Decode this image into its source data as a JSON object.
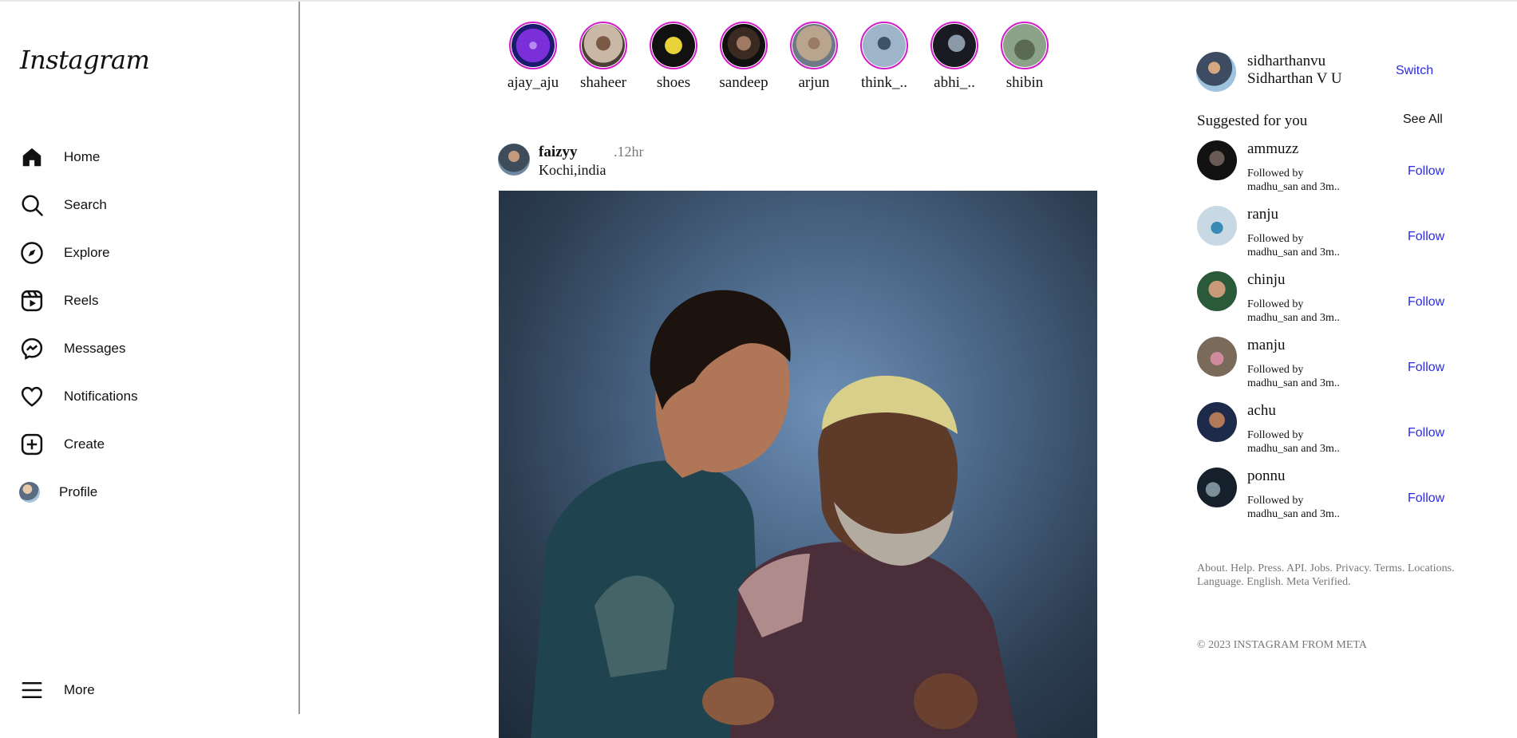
{
  "app": {
    "logo_text": "Instagram"
  },
  "sidebar": {
    "items": [
      {
        "label": "Home",
        "icon": "home-icon"
      },
      {
        "label": "Search",
        "icon": "search-icon"
      },
      {
        "label": "Explore",
        "icon": "compass-icon"
      },
      {
        "label": "Reels",
        "icon": "reels-icon"
      },
      {
        "label": "Messages",
        "icon": "messenger-icon"
      },
      {
        "label": "Notifications",
        "icon": "heart-icon"
      },
      {
        "label": "Create",
        "icon": "plus-square-icon"
      },
      {
        "label": "Profile",
        "icon": "avatar"
      },
      {
        "label": "More",
        "icon": "menu-icon"
      }
    ]
  },
  "stories": [
    {
      "name": "ajay_aju",
      "pic_colors": [
        "#7a2fd8",
        "#1a1a6e"
      ]
    },
    {
      "name": "shaheer",
      "pic_colors": [
        "#c9b8a5",
        "#4a4036"
      ]
    },
    {
      "name": "shoes",
      "pic_colors": [
        "#e8d23a",
        "#111111"
      ]
    },
    {
      "name": "sandeep",
      "pic_colors": [
        "#6b4a3a",
        "#101010"
      ]
    },
    {
      "name": "arjun",
      "pic_colors": [
        "#b9a48d",
        "#6d7a86"
      ]
    },
    {
      "name": "think_..",
      "pic_colors": [
        "#9eb4c8",
        "#3f5368"
      ]
    },
    {
      "name": "abhi_..",
      "pic_colors": [
        "#8a98a8",
        "#1a1a22"
      ]
    },
    {
      "name": "shibin",
      "pic_colors": [
        "#8ca38a",
        "#5a6a55"
      ]
    }
  ],
  "post": {
    "username": "faizyy",
    "time": ".12hr",
    "location": "Kochi,india"
  },
  "me": {
    "username": "sidharthanvu",
    "full_name": "Sidharthan V U",
    "switch_label": "Switch"
  },
  "suggested": {
    "title": "Suggested for you",
    "see_all": "See All",
    "users": [
      {
        "name": "ammuzz",
        "note1": "Followed by",
        "note2": "madhu_san and 3m..",
        "follow": "Follow",
        "pic_colors": [
          "#6a5a55",
          "#121212"
        ]
      },
      {
        "name": "ranju",
        "note1": "Followed by",
        "note2": "madhu_san and 3m..",
        "follow": "Follow",
        "pic_colors": [
          "#3a8ab8",
          "#c8d9e4"
        ]
      },
      {
        "name": "chinju",
        "note1": "Followed by",
        "note2": "madhu_san and 3m..",
        "follow": "Follow",
        "pic_colors": [
          "#c99a7a",
          "#2b5a3a"
        ]
      },
      {
        "name": "manju",
        "note1": "Followed by",
        "note2": "madhu_san and 3m..",
        "follow": "Follow",
        "pic_colors": [
          "#d08aa0",
          "#7a6a5a"
        ]
      },
      {
        "name": "achu",
        "note1": "Followed by",
        "note2": "madhu_san and 3m..",
        "follow": "Follow",
        "pic_colors": [
          "#b07a5a",
          "#1e2a4a"
        ]
      },
      {
        "name": "ponnu",
        "note1": "Followed by",
        "note2": "madhu_san and 3m..",
        "follow": "Follow",
        "pic_colors": [
          "#7a8f9a",
          "#15202a"
        ]
      }
    ]
  },
  "footer": {
    "links": "About. Help. Press. API. Jobs. Privacy. Terms. Locations. Language. English. Meta Verified.",
    "copyright": "© 2023 INSTAGRAM FROM META"
  },
  "colors": {
    "story_ring": "#d21cc7",
    "link_blue": "#2b2be0"
  }
}
